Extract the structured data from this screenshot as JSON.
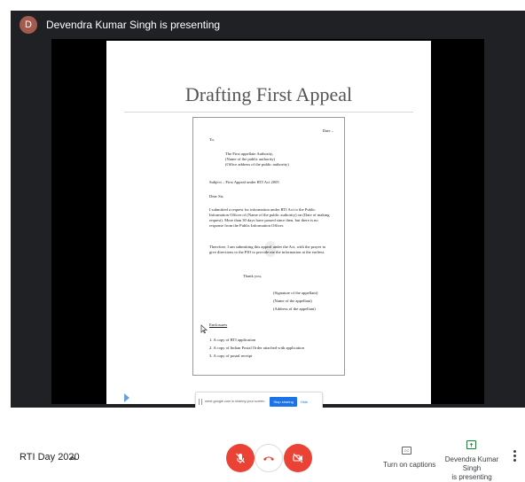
{
  "presenter": {
    "avatar_letter": "D",
    "banner": "Devendra Kumar Singh is presenting"
  },
  "slide": {
    "title": "Drafting First Appeal",
    "document": {
      "date": "Date –",
      "to": "To,",
      "address_lines": [
        "The First appellate Authority,",
        "(Name of the public authority)",
        "(Office address of the public authority)"
      ],
      "subject": "Subject – First Appeal under RTI Act 2005",
      "salutation": "Dear Sir,",
      "paragraph_1": "I submitted a request for information under RTI Act to the Public Information Officer of (Name of the public authority) on (Date of making request). More than 30 days have passed since then, but there is no response from the Public Information Officer.",
      "paragraph_2": "Therefore, I am submitting this appeal under the Act, with the prayer to give directions to the PIO to provide me the information at the earliest.",
      "closing": "Thank you,",
      "signature_lines": [
        "(Signature of the appellant)",
        "(Name of the appellant)",
        "(Address of the appellant)"
      ],
      "enclosures_heading": "Enclosures",
      "enclosures": [
        "1. A copy of RTI application",
        "2. A copy of Indian Postal Order attached with application",
        "3. A copy of postal receipt"
      ]
    }
  },
  "share_notice": {
    "text": "meet.google.com is sharing your screen.",
    "stop_label": "Stop sharing",
    "hide_label": "Hide"
  },
  "controls": {
    "meeting_name": "RTI Day 2020",
    "captions_label": "Turn on captions",
    "cc_glyph": "CC",
    "presenting_label_1": "Devendra Kumar Singh",
    "presenting_label_2": "is presenting"
  },
  "colors": {
    "stage_bg": "#202124",
    "danger": "#ea4335",
    "accent": "#1a73e8",
    "present_green": "#188038"
  }
}
